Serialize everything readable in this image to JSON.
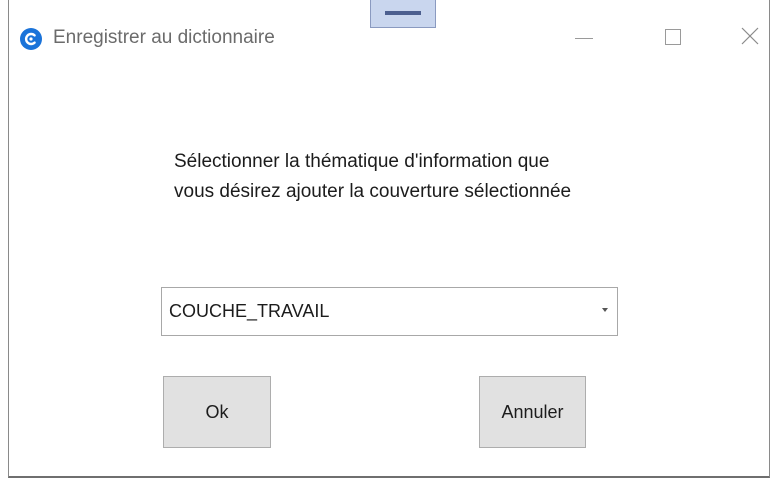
{
  "window": {
    "title": "Enregistrer au dictionnaire",
    "icon": "app-logo-icon",
    "controls": {
      "minimize": "minimize-icon",
      "maximize": "maximize-icon",
      "close": "close-icon"
    }
  },
  "prompt": {
    "line1": "Sélectionner la thématique d'information que",
    "line2": "vous désirez ajouter la couverture sélectionnée"
  },
  "combo": {
    "selected": "COUCHE_TRAVAIL",
    "arrow_icon": "chevron-down-icon"
  },
  "buttons": {
    "ok": "Ok",
    "cancel": "Annuler"
  },
  "colors": {
    "accent": "#1a73d9",
    "button_bg": "#e1e1e1",
    "title_text": "#6b6b6b"
  }
}
